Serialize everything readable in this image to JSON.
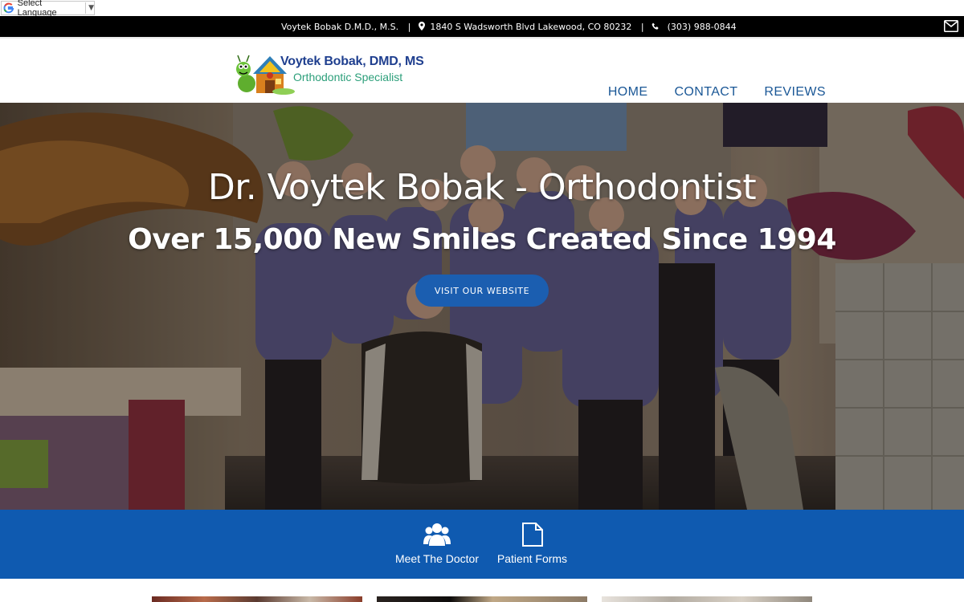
{
  "translate": {
    "label": "Select Language",
    "arrow": "▼"
  },
  "topbar": {
    "name": "Voytek Bobak D.M.D., M.S.",
    "separator": "|",
    "address": "1840 S Wadsworth Blvd  Lakewood,  CO  80232",
    "phone": "(303) 988-0844"
  },
  "logo": {
    "title": "Voytek Bobak, DMD, MS",
    "subtitle": "Orthodontic Specialist"
  },
  "nav": [
    {
      "label": "HOME"
    },
    {
      "label": "CONTACT"
    },
    {
      "label": "REVIEWS"
    }
  ],
  "hero": {
    "title": "Dr. Voytek Bobak - Orthodontist",
    "subtitle": "Over 15,000 New Smiles Created Since 1994",
    "button": "VISIT OUR WEBSITE"
  },
  "features": [
    {
      "label": "Meet The Doctor",
      "icon": "users-icon"
    },
    {
      "label": "Patient Forms",
      "icon": "document-icon"
    }
  ],
  "colors": {
    "primary_blue": "#0f5ab0",
    "nav_blue": "#1a5796",
    "logo_navy": "#1f3f8f",
    "logo_green": "#2c9f7a",
    "topbar_bg": "#000000"
  }
}
